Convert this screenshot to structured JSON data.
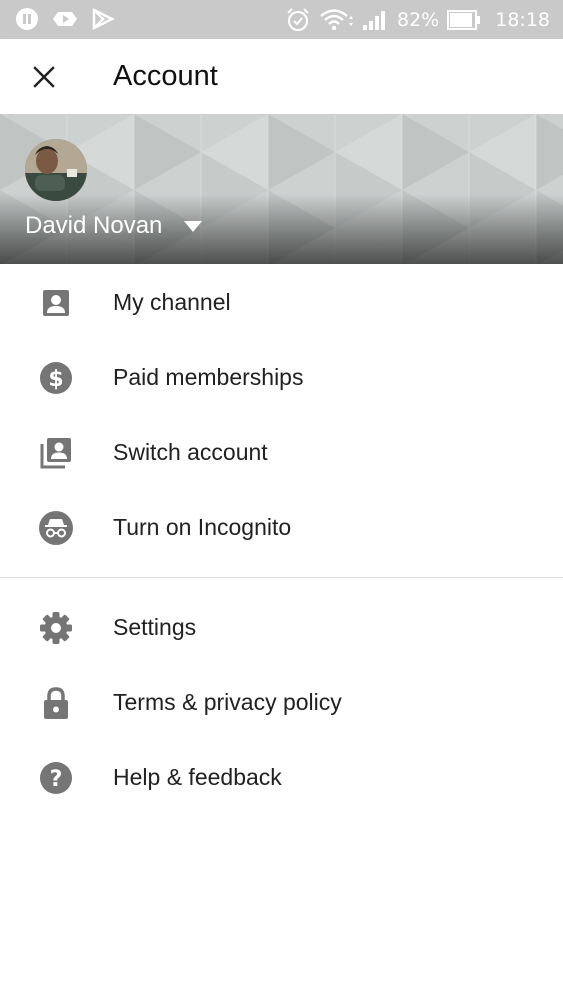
{
  "status_bar": {
    "battery_percent": "82%",
    "time": "18:18",
    "left_icons": [
      "pause-icon",
      "video-icon",
      "play-store-icon"
    ],
    "right_icons": [
      "alarm-icon",
      "wifi-icon",
      "signal-icon",
      "battery-icon"
    ]
  },
  "header": {
    "close_icon": "close-icon",
    "title": "Account"
  },
  "account": {
    "name": "David Novan",
    "dropdown_icon": "dropdown-triangle-icon"
  },
  "menu": {
    "primary": [
      {
        "label": "My channel",
        "icon": "account-box-icon"
      },
      {
        "label": "Paid memberships",
        "icon": "dollar-circle-icon"
      },
      {
        "label": "Switch account",
        "icon": "switch-account-icon"
      },
      {
        "label": "Turn on Incognito",
        "icon": "incognito-icon"
      }
    ],
    "secondary": [
      {
        "label": "Settings",
        "icon": "gear-icon"
      },
      {
        "label": "Terms & privacy policy",
        "icon": "lock-icon"
      },
      {
        "label": "Help & feedback",
        "icon": "help-icon"
      }
    ]
  },
  "colors": {
    "status_bar": "#c9c9c9",
    "icon_gray": "#757575",
    "text_primary": "#212121",
    "banner": "#cdd1d0"
  }
}
